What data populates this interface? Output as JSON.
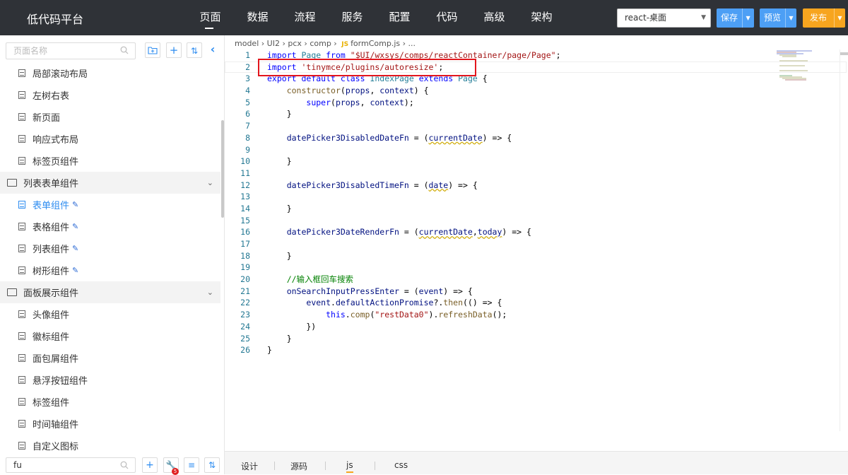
{
  "app": {
    "title": "低代码平台"
  },
  "nav": [
    "页面",
    "数据",
    "流程",
    "服务",
    "配置",
    "代码",
    "高级",
    "架构"
  ],
  "env_select": {
    "value": "react-桌面"
  },
  "actions": {
    "save": "保存",
    "preview": "预览",
    "publish": "发布"
  },
  "sidebar": {
    "search_placeholder": "页面名称",
    "tree": [
      {
        "kind": "leaf",
        "label": "局部滚动布局"
      },
      {
        "kind": "leaf",
        "label": "左树右表"
      },
      {
        "kind": "leaf",
        "label": "新页面"
      },
      {
        "kind": "leaf",
        "label": "响应式布局"
      },
      {
        "kind": "leaf",
        "label": "标签页组件"
      },
      {
        "kind": "group",
        "label": "列表表单组件"
      },
      {
        "kind": "leaf",
        "label": "表单组件",
        "active": true,
        "editable": true
      },
      {
        "kind": "leaf",
        "label": "表格组件",
        "editable": true
      },
      {
        "kind": "leaf",
        "label": "列表组件",
        "editable": true
      },
      {
        "kind": "leaf",
        "label": "树形组件",
        "editable": true
      },
      {
        "kind": "group",
        "label": "面板展示组件"
      },
      {
        "kind": "leaf",
        "label": "头像组件"
      },
      {
        "kind": "leaf",
        "label": "徽标组件"
      },
      {
        "kind": "leaf",
        "label": "面包屑组件"
      },
      {
        "kind": "leaf",
        "label": "悬浮按钮组件"
      },
      {
        "kind": "leaf",
        "label": "标签组件"
      },
      {
        "kind": "leaf",
        "label": "时间轴组件"
      },
      {
        "kind": "leaf",
        "label": "自定义图标"
      }
    ],
    "bottom_search_value": "fu",
    "badge_count": "5"
  },
  "editor": {
    "breadcrumb": [
      "model",
      "UI2",
      "pcx",
      "comp",
      "formComp.js",
      "..."
    ],
    "file_badge": "JS",
    "lines": [
      "import Page from \"$UI/wxsys/comps/reactContainer/page/Page\";",
      "import 'tinymce/plugins/autoresize';",
      "export default class IndexPage extends Page {",
      "    constructor(props, context) {",
      "        super(props, context);",
      "    }",
      "",
      "    datePicker3DisabledDateFn = (currentDate) => {",
      "",
      "    }",
      "",
      "    datePicker3DisabledTimeFn = (date) => {",
      "",
      "    }",
      "",
      "    datePicker3DateRenderFn = (currentDate,today) => {",
      "",
      "    }",
      "",
      "    //输入框回车搜索",
      "    onSearchInputPressEnter = (event) => {",
      "        event.defaultActionPromise?.then(() => {",
      "            this.comp(\"restData0\").refreshData();",
      "        })",
      "    }",
      "}"
    ]
  },
  "bottom_tabs": [
    "设计",
    "源码",
    "js",
    "css"
  ]
}
